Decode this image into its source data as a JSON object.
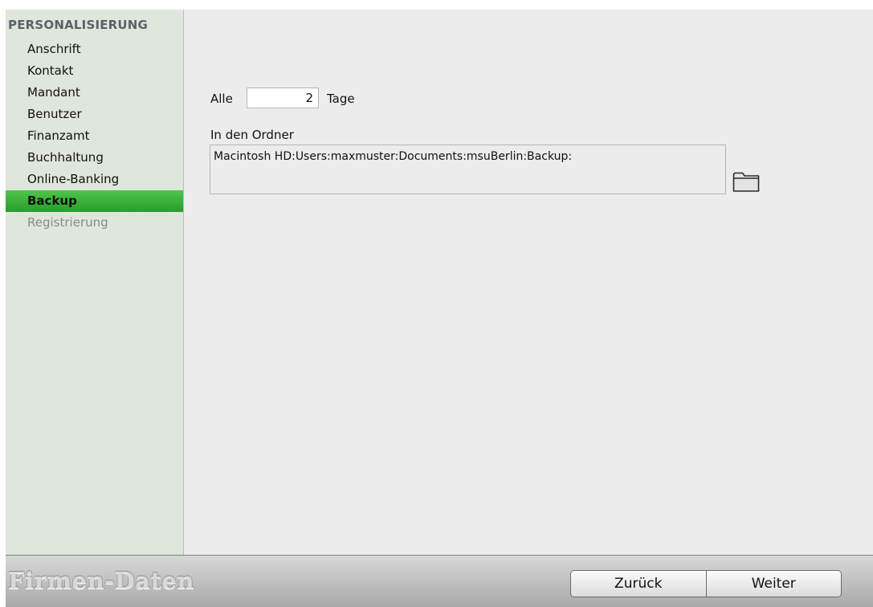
{
  "sidebar": {
    "header": "PERSONALISIERUNG",
    "items": [
      {
        "label": "Anschrift"
      },
      {
        "label": "Kontakt"
      },
      {
        "label": "Mandant"
      },
      {
        "label": "Benutzer"
      },
      {
        "label": "Finanzamt"
      },
      {
        "label": "Buchhaltung"
      },
      {
        "label": "Online-Banking"
      },
      {
        "label": "Backup",
        "selected": true
      },
      {
        "label": "Registrierung",
        "disabled": true
      }
    ]
  },
  "backup": {
    "interval_prefix": "Alle",
    "interval_value": "2",
    "interval_suffix": "Tage",
    "folder_label": "In den Ordner",
    "folder_path": "Macintosh HD:Users:maxmuster:Documents:msuBerlin:Backup:",
    "folder_icon": "folder-icon"
  },
  "footer": {
    "brand": "Firmen-Daten",
    "back_label": "Zurück",
    "next_label": "Weiter"
  },
  "colors": {
    "selection_green": "#3cb23b",
    "sidebar_bg": "#dfe6dc",
    "panel_bg": "#ececec"
  }
}
